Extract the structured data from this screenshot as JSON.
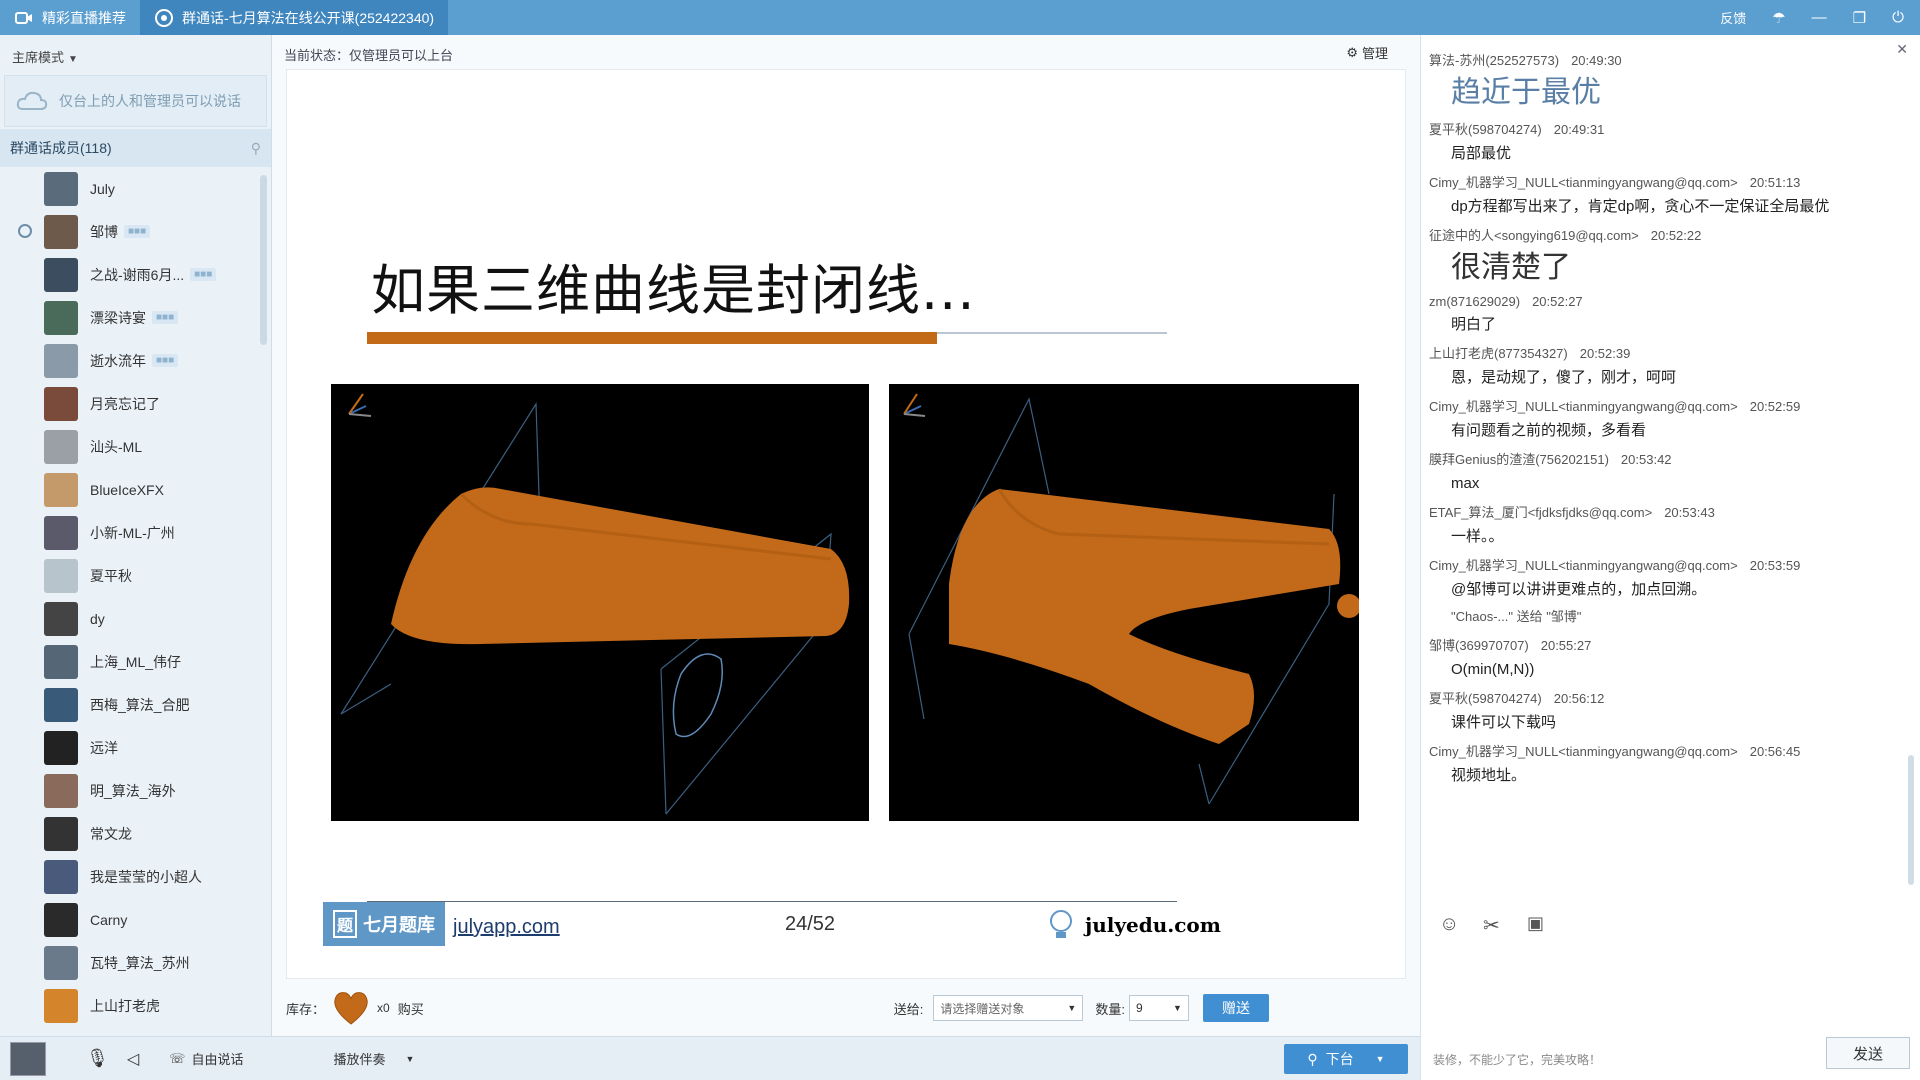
{
  "titlebar": {
    "tab1": "精彩直播推荐",
    "tab2": "群通话-七月算法在线公开课(252422340)",
    "feedback": "反馈"
  },
  "left": {
    "mode": "主席模式",
    "notice": "仅台上的人和管理员可以说话",
    "members_header": "群通话成员(118)",
    "members": [
      {
        "name": "July",
        "badge": ""
      },
      {
        "name": "邹博",
        "badge": "■■■"
      },
      {
        "name": "之战-谢雨6月...",
        "badge": "■■■"
      },
      {
        "name": "漂梁诗宴",
        "badge": "■■■"
      },
      {
        "name": "逝水流年",
        "badge": "■■■"
      },
      {
        "name": "月亮忘记了",
        "badge": ""
      },
      {
        "name": "汕头-ML",
        "badge": ""
      },
      {
        "name": "BlueIceXFX",
        "badge": ""
      },
      {
        "name": "小新-ML-广州",
        "badge": ""
      },
      {
        "name": "夏平秋",
        "badge": ""
      },
      {
        "name": "dy",
        "badge": ""
      },
      {
        "name": "上海_ML_伟仔",
        "badge": ""
      },
      {
        "name": "西梅_算法_合肥",
        "badge": ""
      },
      {
        "name": "远洋",
        "badge": ""
      },
      {
        "name": "明_算法_海外",
        "badge": ""
      },
      {
        "name": "常文龙",
        "badge": ""
      },
      {
        "name": "我是莹莹的小超人",
        "badge": ""
      },
      {
        "name": "Carny",
        "badge": ""
      },
      {
        "name": "瓦特_算法_苏州",
        "badge": ""
      },
      {
        "name": "上山打老虎",
        "badge": ""
      }
    ],
    "avatar_colors": [
      "#5a6b7c",
      "#6d5a4a",
      "#3b4d5e",
      "#4a6a5a",
      "#8a9aa8",
      "#7a4a3a",
      "#9aa0a6",
      "#c49a6a",
      "#5a5a6a",
      "#b8c4cc",
      "#444",
      "#556677",
      "#3a5a7a",
      "#222",
      "#8a6a5a",
      "#333",
      "#4a5a7a",
      "#2a2a2a",
      "#6a7a8a",
      "#d4842a"
    ]
  },
  "bottom": {
    "freespeak": "自由说话",
    "accompany": "播放伴奏"
  },
  "center": {
    "status": "当前状态：仅管理员可以上台",
    "manage": "管理",
    "slide_title": "如果三维曲线是封闭线...",
    "logo_text": "七月题库",
    "logo_icon": "题",
    "logo_url": "julyapp.com",
    "page": "24/52",
    "julyedu": "julyedu.com",
    "gift": {
      "stock_label": "库存：",
      "count": "x0",
      "buy": "购买",
      "send_to_label": "送给:",
      "send_to_placeholder": "请选择赠送对象",
      "qty_label": "数量:",
      "qty_value": "9",
      "give": "赠送",
      "stage": "下台"
    }
  },
  "chat": {
    "messages": [
      {
        "name": "算法-苏州(252527573)",
        "time": "20:49:30",
        "text": "趋近于最优",
        "style": "big"
      },
      {
        "name": "夏平秋(598704274)",
        "time": "20:49:31",
        "text": "局部最优",
        "style": ""
      },
      {
        "name": "Cimy_机器学习_NULL<tianmingyangwang@qq.com>",
        "time": "20:51:13",
        "text": "dp方程都写出来了，肯定dp啊，贪心不一定保证全局最优",
        "style": ""
      },
      {
        "name": "征途中的人<songying619@qq.com>",
        "time": "20:52:22",
        "text": "很清楚了",
        "style": "big2"
      },
      {
        "name": "zm(871629029)",
        "time": "20:52:27",
        "text": "明白了",
        "style": ""
      },
      {
        "name": "上山打老虎(877354327)",
        "time": "20:52:39",
        "text": "恩，是动规了，傻了，刚才，呵呵",
        "style": ""
      },
      {
        "name": "Cimy_机器学习_NULL<tianmingyangwang@qq.com>",
        "time": "20:52:59",
        "text": "有问题看之前的视频，多看看",
        "style": ""
      },
      {
        "name": "膜拜Genius的渣渣(756202151)",
        "time": "20:53:42",
        "text": "max",
        "style": ""
      },
      {
        "name": "ETAF_算法_厦门<fjdksfjdks@qq.com>",
        "time": "20:53:43",
        "text": "一样。。",
        "style": ""
      },
      {
        "name": "Cimy_机器学习_NULL<tianmingyangwang@qq.com>",
        "time": "20:53:59",
        "text": "@邹博可以讲讲更难点的，加点回溯。",
        "style": ""
      },
      {
        "name": "",
        "time": "",
        "text": "\"Chaos-...\" 送给 \"邹博\"",
        "style": "gift"
      },
      {
        "name": "邹博(369970707)",
        "time": "20:55:27",
        "text": "O(min(M,N))",
        "style": ""
      },
      {
        "name": "夏平秋(598704274)",
        "time": "20:56:12",
        "text": "课件可以下载吗",
        "style": ""
      },
      {
        "name": "Cimy_机器学习_NULL<tianmingyangwang@qq.com>",
        "time": "20:56:45",
        "text": "视频地址。",
        "style": ""
      }
    ],
    "input_hint": "装修，不能少了它，完美攻略！",
    "send": "发送"
  }
}
